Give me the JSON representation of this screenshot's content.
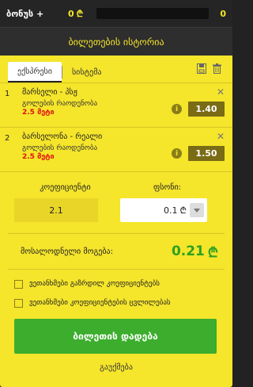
{
  "bonus": {
    "label": "ბონუს +",
    "value": "0",
    "currency": "₾",
    "progress": 0,
    "end": "0"
  },
  "history": {
    "title": "ბილეთების ისტორია"
  },
  "tabs": [
    {
      "label": "ექსპრესი",
      "active": true
    },
    {
      "label": "სისტემა",
      "active": false
    }
  ],
  "icons": [
    "save-icon",
    "trash-icon"
  ],
  "bets": [
    {
      "num": "1",
      "match": "მარსელი - პსჟ",
      "market": "გოლების რაოდენობა",
      "old_odds": "2.5 მეტი",
      "odds": "1.40",
      "close": "✕",
      "info": "i"
    },
    {
      "num": "2",
      "match": "ბარსელონა - რეალი",
      "market": "გოლების რაოდენობა",
      "old_odds": "2.5 მეტი",
      "odds": "1.50",
      "close": "✕",
      "info": "i"
    }
  ],
  "coef": {
    "label": "კოეფიციენტი",
    "value": "2.1"
  },
  "stake": {
    "label": "ფსონი:",
    "value": "0.1",
    "currency": "₾"
  },
  "win": {
    "label": "მოსალოდნელი მოგება:",
    "value": "0.21",
    "currency": "₾"
  },
  "checks": [
    "ვეთანხმები გაზრდილ კოეფიციენტებს",
    "ვეთანხმები კოეფიციენტების ცვლილებას"
  ],
  "place_button": "ბილეთის დადება",
  "cancel": "გაუქმება",
  "colors": {
    "accent": "#f5e52b",
    "green": "#3cad2d",
    "red": "#d11111"
  }
}
